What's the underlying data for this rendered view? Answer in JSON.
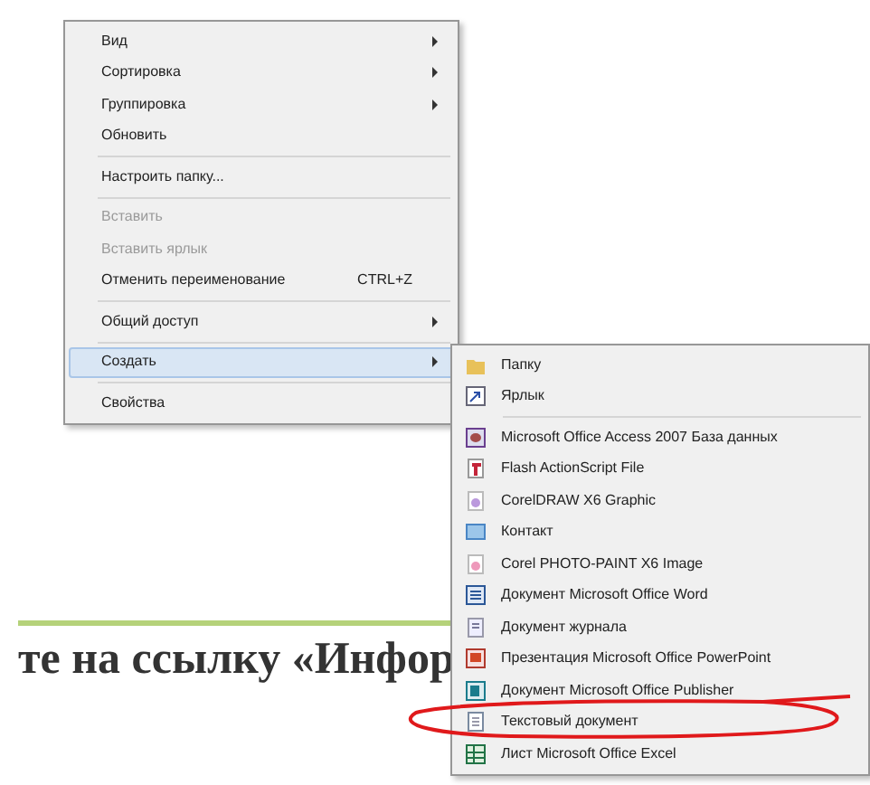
{
  "background_text": "те на ссылку «Инфор",
  "context_menu": {
    "groups": [
      [
        {
          "label": "Вид",
          "submenu": true,
          "disabled": false,
          "selected": false
        },
        {
          "label": "Сортировка",
          "submenu": true,
          "disabled": false,
          "selected": false
        },
        {
          "label": "Группировка",
          "submenu": true,
          "disabled": false,
          "selected": false
        },
        {
          "label": "Обновить",
          "submenu": false,
          "disabled": false,
          "selected": false
        }
      ],
      [
        {
          "label": "Настроить папку...",
          "submenu": false,
          "disabled": false,
          "selected": false
        }
      ],
      [
        {
          "label": "Вставить",
          "submenu": false,
          "disabled": true,
          "selected": false
        },
        {
          "label": "Вставить ярлык",
          "submenu": false,
          "disabled": true,
          "selected": false
        },
        {
          "label": "Отменить переименование",
          "shortcut": "CTRL+Z",
          "submenu": false,
          "disabled": false,
          "selected": false
        }
      ],
      [
        {
          "label": "Общий доступ",
          "submenu": true,
          "disabled": false,
          "selected": false
        }
      ],
      [
        {
          "label": "Создать",
          "submenu": true,
          "disabled": false,
          "selected": true
        }
      ],
      [
        {
          "label": "Свойства",
          "submenu": false,
          "disabled": false,
          "selected": false
        }
      ]
    ]
  },
  "submenu": {
    "groups": [
      [
        {
          "label": "Папку"
        },
        {
          "label": "Ярлык"
        }
      ],
      [
        {
          "label": "Microsoft Office Access 2007 База данных"
        },
        {
          "label": "Flash ActionScript File"
        },
        {
          "label": "CorelDRAW X6 Graphic"
        },
        {
          "label": "Контакт"
        },
        {
          "label": "Corel PHOTO-PAINT X6 Image"
        },
        {
          "label": "Документ Microsoft Office Word"
        },
        {
          "label": "Документ журнала"
        },
        {
          "label": "Презентация Microsoft Office PowerPoint"
        },
        {
          "label": "Документ Microsoft Office Publisher"
        },
        {
          "label": "Текстовый документ"
        },
        {
          "label": "Лист Microsoft Office Excel"
        }
      ]
    ]
  }
}
